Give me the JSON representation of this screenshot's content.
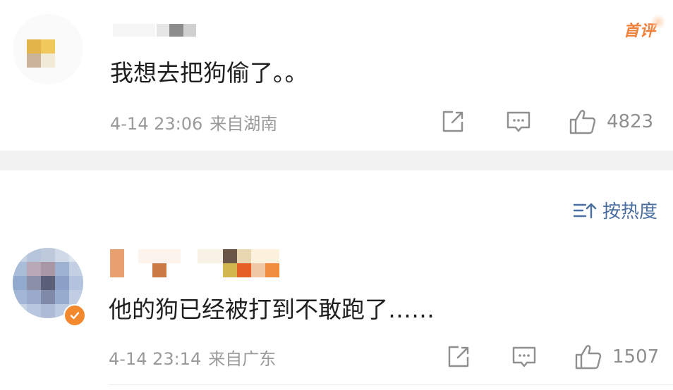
{
  "comments": [
    {
      "first_badge": "首评",
      "text": "我想去把狗偷了。。",
      "time": "4-14 23:06",
      "location": "来自湖南",
      "likes": "4823"
    },
    {
      "text": "他的狗已经被打到不敢跑了……",
      "time": "4-14 23:14",
      "location": "来自广东",
      "likes": "1507",
      "verified": true
    }
  ],
  "sort": {
    "label": "按热度"
  },
  "icons": {
    "share": "share-icon",
    "comment": "comment-icon",
    "like": "thumbs-up-icon",
    "sort": "sort-icon",
    "verified": "verified-check-icon"
  },
  "colors": {
    "accent_orange": "#f0813b",
    "sort_blue": "#4a6fa0",
    "meta_gray": "#9a9a9a"
  }
}
